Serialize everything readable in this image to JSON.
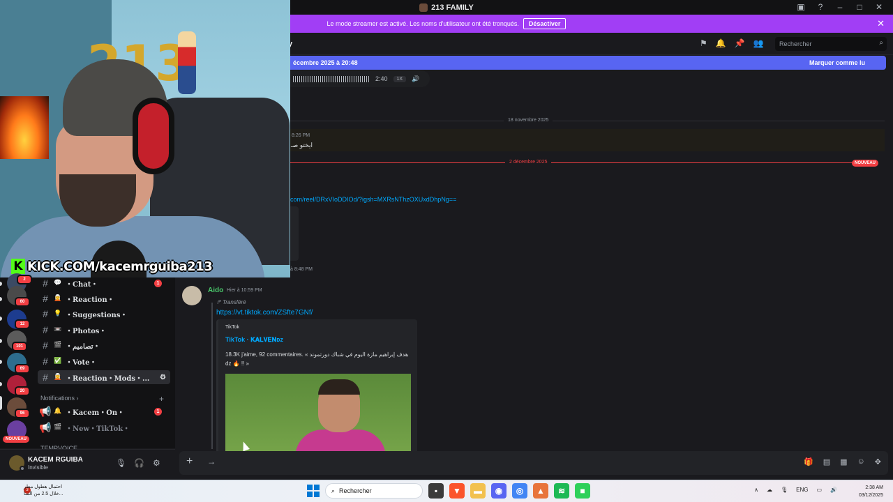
{
  "titlebar": {
    "server_name": "213 FAMILY",
    "controls": [
      "inbox-icon",
      "help-icon",
      "minimize-icon",
      "maximize-icon",
      "close-icon"
    ]
  },
  "streamer_banner": {
    "text": "Le mode streamer est activé. Les noms d'utilisateur ont été tronqués.",
    "button": "Désactiver"
  },
  "channel_header": {
    "title_fragment": "y",
    "search_placeholder": "Rechercher"
  },
  "unread_bar": {
    "date_text": "écembre 2025 à 20:48",
    "mark_read": "Marquer comme lu"
  },
  "audio": {
    "duration": "2:40",
    "speed": "1X"
  },
  "messages": {
    "date_divider_1": "18 novembre 2025",
    "msg1_time": "8:26 PM",
    "msg1_text": "ايختو صـ",
    "date_divider_2": "2 décembre 2025",
    "new_badge": "NOUVEAU",
    "reel_link": "com/reel/DRxVIoDDIOd/?igsh=MXRsNThzOXUxdDhpNg==",
    "partial_time": "à 8:48 PM"
  },
  "aido": {
    "name": "Aido",
    "time": "Hier à 10:59 PM",
    "forwarded": "Transféré",
    "link": "https://vt.tiktok.com/ZSfte7GNf/",
    "embed": {
      "provider": "TikTok",
      "title": "TikTok · 𝐊𝐀𝐋𝐕𝐄𝐍ᴅᴢ",
      "description": "18.3K j'aime, 92 commentaires. « هدف إبراهيم مازة اليوم في شباك دورتموند dz 🔥 !! »"
    }
  },
  "webcam": {
    "overlay_text": "KICK.COM/kacemrguiba213",
    "balloon_text": "213"
  },
  "guilds": [
    {
      "badge": "2",
      "color": "#3b4a63"
    },
    {
      "badge": "60",
      "color": "#4a4a4a"
    },
    {
      "badge": "12",
      "color": "#1d3c8f"
    },
    {
      "badge": "101",
      "color": "#5b5b5b"
    },
    {
      "badge": "69",
      "color": "#2d6d8e"
    },
    {
      "badge": "20",
      "color": "#b0203a"
    },
    {
      "badge": "96",
      "color": "#6b4c3b"
    },
    {
      "badge": "",
      "color": "#6a3fa0"
    }
  ],
  "guild_new_label": "NOUVEAU",
  "sidebar": {
    "channels": [
      {
        "emoji": "💬",
        "name": "・Chat・",
        "unread": "1"
      },
      {
        "emoji": "🧝",
        "name": "・Reaction・",
        "unread": ""
      },
      {
        "emoji": "💡",
        "name": "・Suggestions・",
        "unread": ""
      },
      {
        "emoji": "📼",
        "name": "・Photos・",
        "unread": ""
      },
      {
        "emoji": "🎬",
        "name": "・تصاميم・",
        "unread": ""
      },
      {
        "emoji": "✅",
        "name": "・Vote・",
        "unread": ""
      },
      {
        "emoji": "🧝",
        "name": "・Reaction・Mods・...",
        "unread": ""
      }
    ],
    "category_notifications": "Notifications",
    "notif_channels": [
      {
        "emoji": "🔔",
        "name": "・Kacem・On・",
        "unread": "1"
      },
      {
        "emoji": "🎬",
        "name": "・New・TikTok・",
        "unread": ""
      }
    ],
    "category_voice": "TEMPVOICE"
  },
  "user_panel": {
    "name": "KACEM RGUIBA",
    "status": "Invisible"
  },
  "taskbar": {
    "weather_line1": "احتمال هطول مطر",
    "weather_line2": "خلال 2.5 من السا...",
    "weather_badge": "3",
    "search": "Rechercher",
    "lang": "ENG",
    "time": "2:38 AM",
    "date": "03/12/2025"
  }
}
